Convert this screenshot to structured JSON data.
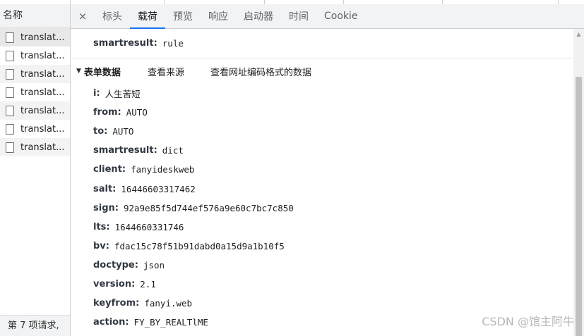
{
  "left_panel": {
    "header": "名称",
    "requests": [
      "translat...",
      "translat...",
      "translat...",
      "translat...",
      "translat...",
      "translat...",
      "translat..."
    ],
    "footer": "第 7 项请求,"
  },
  "tabs": {
    "close": "×",
    "items": [
      "标头",
      "载荷",
      "预览",
      "响应",
      "启动器",
      "时间",
      "Cookie"
    ],
    "active": "载荷"
  },
  "query_param": {
    "key": "smartresult:",
    "value": "rule"
  },
  "form_section": {
    "toggle": "▼",
    "title": "表单数据",
    "view_source": "查看来源",
    "view_url_encoded": "查看网址编码格式的数据"
  },
  "form_params": [
    {
      "key": "i:",
      "value": "人生苦短"
    },
    {
      "key": "from:",
      "value": "AUTO"
    },
    {
      "key": "to:",
      "value": "AUTO"
    },
    {
      "key": "smartresult:",
      "value": "dict"
    },
    {
      "key": "client:",
      "value": "fanyideskweb"
    },
    {
      "key": "salt:",
      "value": "16446603317462"
    },
    {
      "key": "sign:",
      "value": "92a9e85f5d744ef576a9e60c7bc7c850"
    },
    {
      "key": "lts:",
      "value": "1644660331746"
    },
    {
      "key": "bv:",
      "value": "fdac15c78f51b91dabd0a15d9a1b10f5"
    },
    {
      "key": "doctype:",
      "value": "json"
    },
    {
      "key": "version:",
      "value": "2.1"
    },
    {
      "key": "keyfrom:",
      "value": "fanyi.web"
    },
    {
      "key": "action:",
      "value": "FY_BY_REALTlME"
    }
  ],
  "watermark": "CSDN @馆主阿牛",
  "colors": {
    "active_tab_underline": "#1a73e8",
    "panel_bg": "#f1f3f4"
  }
}
